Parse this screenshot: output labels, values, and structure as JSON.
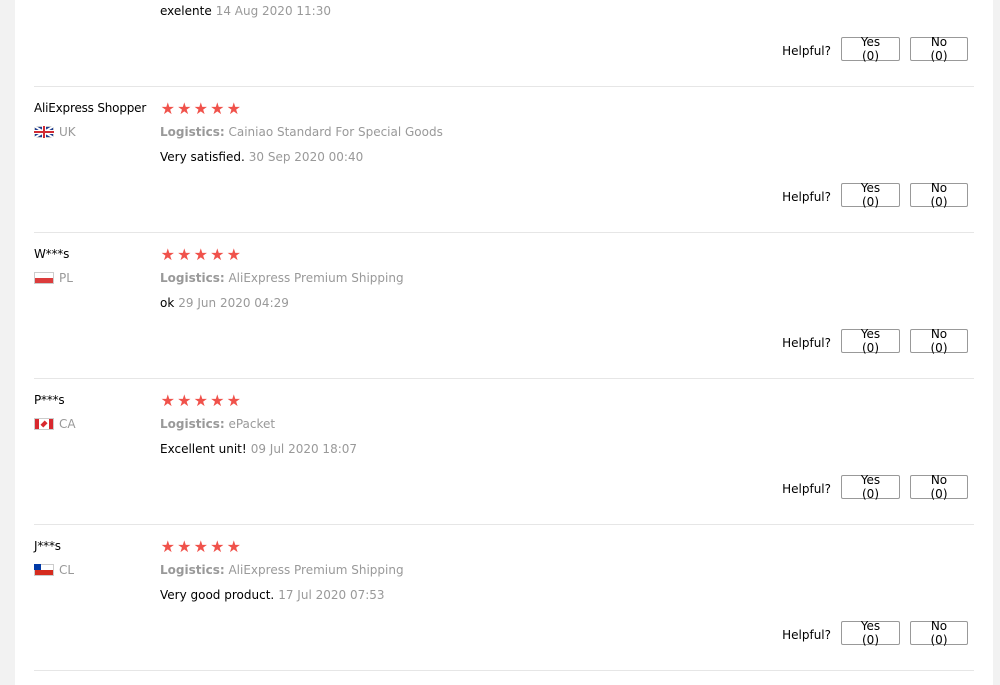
{
  "labels": {
    "helpful": "Helpful?",
    "logistics": "Logistics:"
  },
  "first_review": {
    "feedback_text": "exelente",
    "date": "14 Aug 2020 11:30",
    "yes_label": "Yes (0)",
    "no_label": "No (0)"
  },
  "reviews": [
    {
      "user_name": "AliExpress Shopper",
      "country_code": "UK",
      "flag": "uk",
      "rating": 5,
      "logistics": "Cainiao Standard For Special Goods",
      "feedback_text": "Very satisfied.",
      "date": "30 Sep 2020 00:40",
      "yes_label": "Yes (0)",
      "no_label": "No (0)"
    },
    {
      "user_name": "W***s",
      "country_code": "PL",
      "flag": "pl",
      "rating": 5,
      "logistics": "AliExpress Premium Shipping",
      "feedback_text": "ok",
      "date": "29 Jun 2020 04:29",
      "yes_label": "Yes (0)",
      "no_label": "No (0)"
    },
    {
      "user_name": "P***s",
      "country_code": "CA",
      "flag": "ca",
      "rating": 5,
      "logistics": "ePacket",
      "feedback_text": "Excellent unit!",
      "date": "09 Jul 2020 18:07",
      "yes_label": "Yes (0)",
      "no_label": "No (0)"
    },
    {
      "user_name": "J***s",
      "country_code": "CL",
      "flag": "cl",
      "rating": 5,
      "logistics": "AliExpress Premium Shipping",
      "feedback_text": "Very good product.",
      "date": "17 Jul 2020 07:53",
      "yes_label": "Yes (0)",
      "no_label": "No (0)"
    }
  ],
  "colors": {
    "star": "#f0524b",
    "muted_text": "#999999",
    "divider": "#e6e6e6"
  },
  "icons": {
    "star": "star-icon",
    "flag": "flag-icon"
  }
}
